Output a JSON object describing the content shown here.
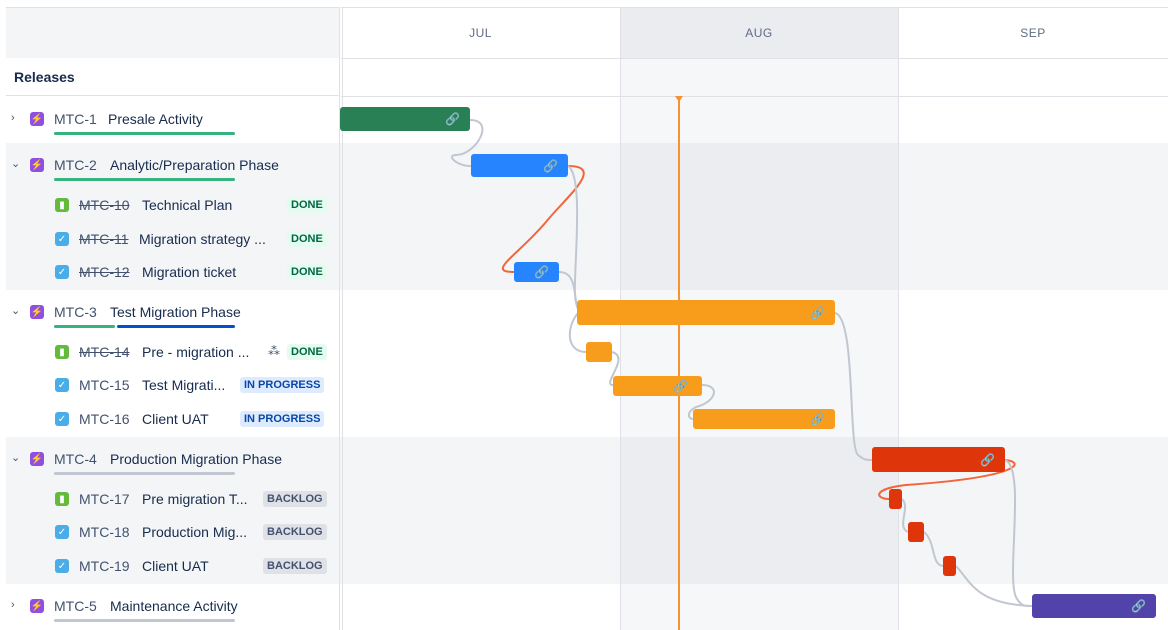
{
  "months": [
    "JUL",
    "AUG",
    "SEP"
  ],
  "releases_label": "Releases",
  "colors": {
    "epic_green": "#2a8055",
    "blue": "#2684ff",
    "orange": "#f89c1c",
    "red": "#de350b",
    "purple": "#5243aa",
    "today": "#f79232",
    "red_link": "#f4643a",
    "grey_link": "#c1c7d0"
  },
  "rows": [
    {
      "type": "epic",
      "expand": "›",
      "key": "MTC-1",
      "title": "Presale Activity",
      "badge": "",
      "icon": "lightning-icon"
    },
    {
      "type": "epic",
      "expand": "⌄",
      "key": "MTC-2",
      "title": "Analytic/Preparation Phase",
      "badge": "",
      "icon": "lightning-icon"
    },
    {
      "type": "story",
      "key": "MTC-10",
      "title": "Technical Plan",
      "badge": "DONE",
      "done": true,
      "icon": "bookmark-icon"
    },
    {
      "type": "task",
      "key": "MTC-11",
      "title": "Migration strategy ...",
      "badge": "DONE",
      "done": true,
      "icon": "checkbox-icon"
    },
    {
      "type": "task",
      "key": "MTC-12",
      "title": "Migration ticket",
      "badge": "DONE",
      "done": true,
      "icon": "checkbox-icon"
    },
    {
      "type": "epic",
      "expand": "⌄",
      "key": "MTC-3",
      "title": "Test Migration Phase",
      "badge": "",
      "icon": "lightning-icon"
    },
    {
      "type": "story",
      "key": "MTC-14",
      "title": "Pre - migration ...",
      "badge": "DONE",
      "done": true,
      "icon": "bookmark-icon",
      "extra": "hierarchy-icon"
    },
    {
      "type": "task",
      "key": "MTC-15",
      "title": "Test Migrati...",
      "badge": "IN PROGRESS",
      "icon": "checkbox-icon"
    },
    {
      "type": "task",
      "key": "MTC-16",
      "title": "Client UAT",
      "badge": "IN PROGRESS",
      "icon": "checkbox-icon"
    },
    {
      "type": "epic",
      "expand": "⌄",
      "key": "MTC-4",
      "title": "Production Migration Phase",
      "badge": "",
      "icon": "lightning-icon"
    },
    {
      "type": "story",
      "key": "MTC-17",
      "title": "Pre migration T...",
      "badge": "BACKLOG",
      "icon": "bookmark-icon"
    },
    {
      "type": "task",
      "key": "MTC-18",
      "title": "Production Mig...",
      "badge": "BACKLOG",
      "icon": "checkbox-icon"
    },
    {
      "type": "task",
      "key": "MTC-19",
      "title": "Client UAT",
      "badge": "BACKLOG",
      "icon": "checkbox-icon"
    },
    {
      "type": "epic",
      "expand": "›",
      "key": "MTC-5",
      "title": "Maintenance Activity",
      "badge": "",
      "icon": "lightning-icon"
    }
  ]
}
